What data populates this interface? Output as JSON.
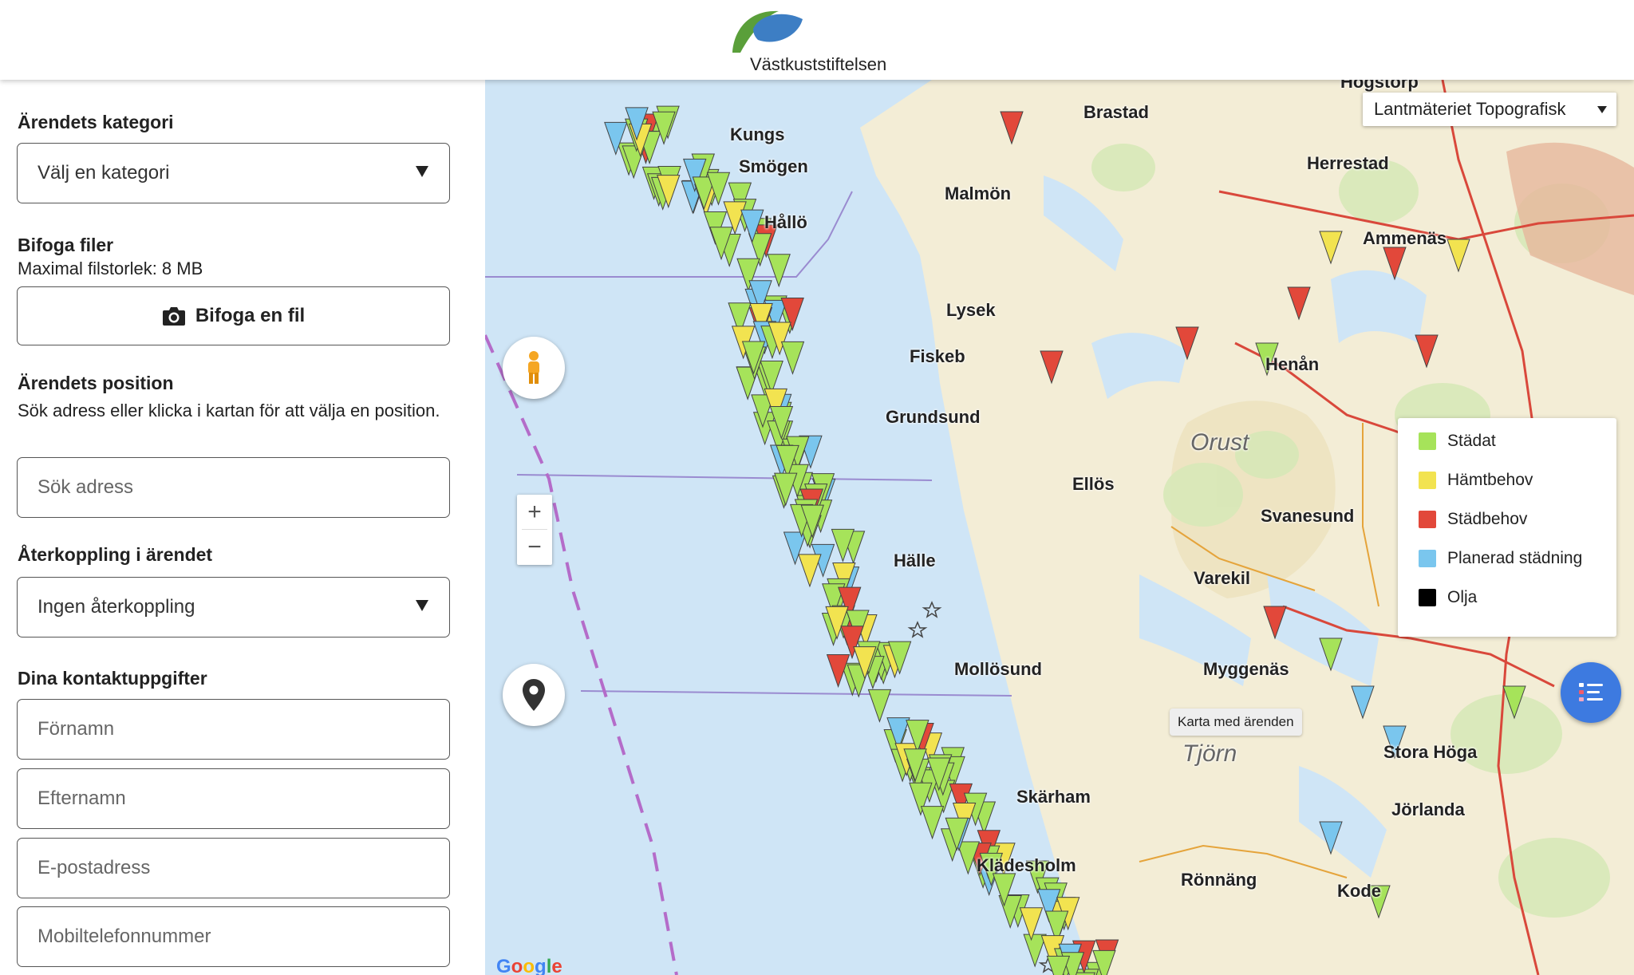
{
  "header": {
    "brand_name": "Västkuststiftelsen"
  },
  "form": {
    "category": {
      "label": "Ärendets kategori",
      "value": "Välj en kategori"
    },
    "attach": {
      "label": "Bifoga filer",
      "max_size": "Maximal filstorlek: 8 MB",
      "button_label": "Bifoga en fil"
    },
    "position": {
      "label": "Ärendets position",
      "help": "Sök adress eller klicka i kartan för att välja en position.",
      "search_placeholder": "Sök adress"
    },
    "feedback": {
      "label": "Återkoppling i ärendet",
      "value": "Ingen återkoppling"
    },
    "contact": {
      "label": "Dina kontaktuppgifter",
      "first_name_placeholder": "Förnamn",
      "last_name_placeholder": "Efternamn",
      "email_placeholder": "E-postadress",
      "phone_placeholder": "Mobiltelefonnummer"
    }
  },
  "map": {
    "map_type": "Lantmäteriet Topografisk",
    "zoom_in": "+",
    "zoom_out": "−",
    "tooltip": "Karta med ärenden",
    "attribution": "Google",
    "legend": [
      {
        "label": "Städat",
        "color": "#a6e35a"
      },
      {
        "label": "Hämtbehov",
        "color": "#f2e350"
      },
      {
        "label": "Städbehov",
        "color": "#e2483a"
      },
      {
        "label": "Planerad städning",
        "color": "#7ac6ee"
      },
      {
        "label": "Olja",
        "color": "#000000"
      }
    ],
    "places": [
      "Kungs",
      "Smögen",
      "Hållö",
      "Malmön",
      "Brastad",
      "Lysek",
      "Fiskeb",
      "Grundsund",
      "Ellös",
      "Orust",
      "Henån",
      "Svanesund",
      "Varekil",
      "Hälle",
      "Mollösund",
      "Myggenäs",
      "Tjörn",
      "Skärham",
      "Klädesholm",
      "Rönnäng",
      "Kode",
      "Stora Höga",
      "Jörlanda",
      "Ammenäs",
      "Herrestad",
      "Högstorp"
    ]
  }
}
